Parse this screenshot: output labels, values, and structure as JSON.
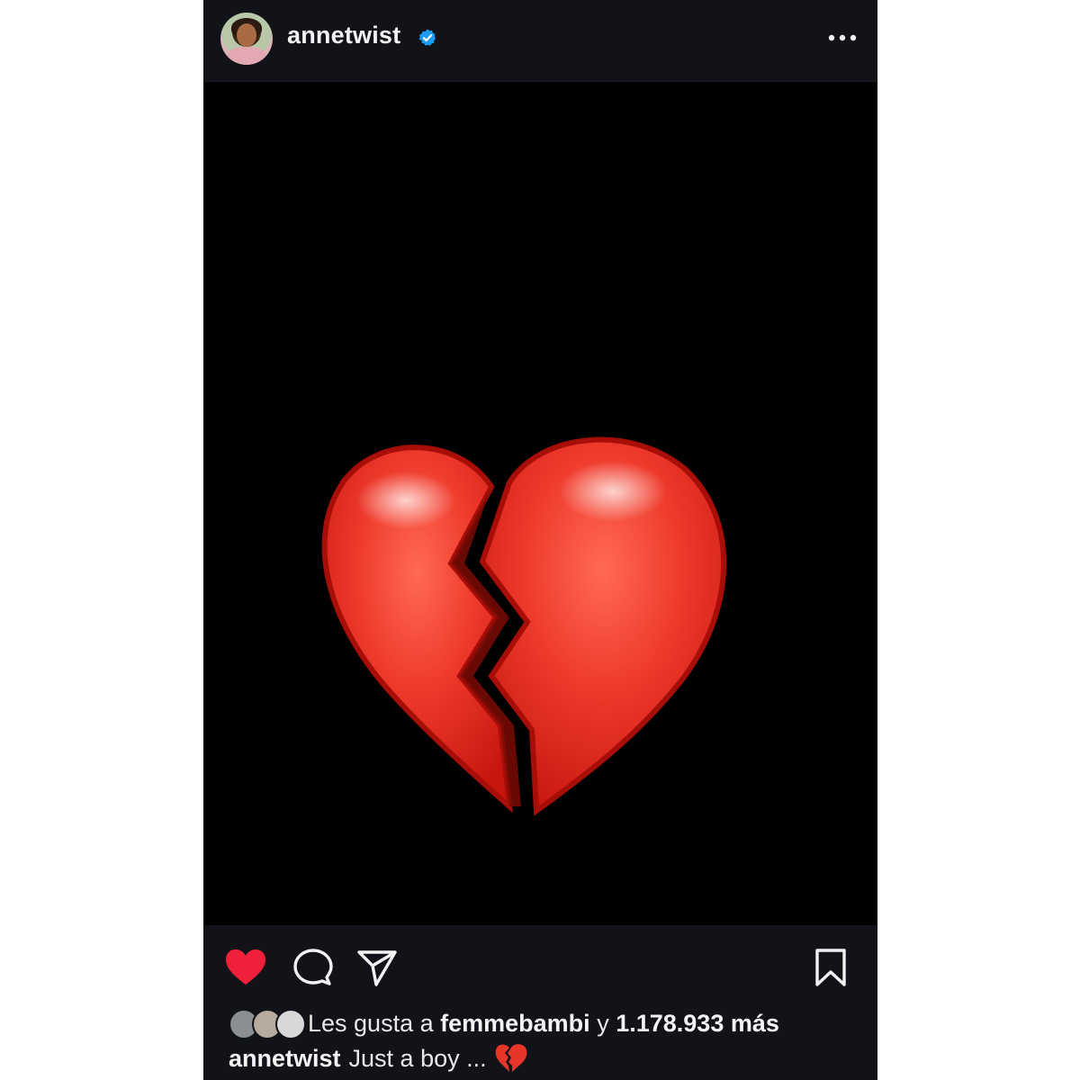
{
  "post": {
    "username": "annetwist",
    "verified": true,
    "verified_color": "#1d9bf0",
    "more_icon": "more-horizontal-icon"
  },
  "media": {
    "background": "#000000",
    "emoji": "broken-heart",
    "emoji_color": "#e8352a"
  },
  "actions": {
    "like_icon": "heart-filled-icon",
    "like_color": "#f0203a",
    "comment_icon": "comment-icon",
    "share_icon": "send-icon",
    "save_icon": "bookmark-icon"
  },
  "likes": {
    "prefix": "Les gusta a",
    "first_user": "femmebambi",
    "connector": "y",
    "count_text": "1.178.933 más"
  },
  "caption": {
    "username": "annetwist",
    "text": "Just a boy ..."
  }
}
